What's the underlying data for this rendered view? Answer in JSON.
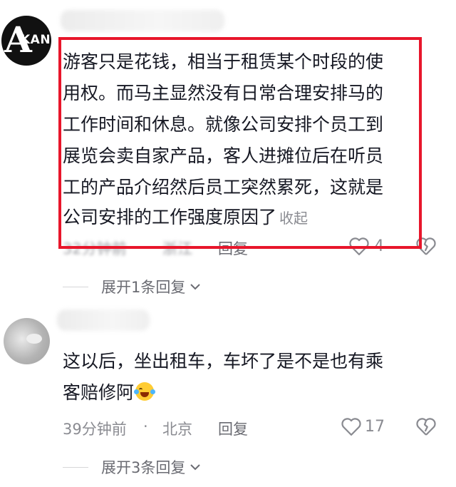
{
  "comments": [
    {
      "avatar_text": "KAN",
      "avatar_letter": "A",
      "lines": [
        "游客只是花钱，相当于租赁某个时段的使",
        "用权。而马主显然没有日常合理安排马的",
        "工作时间和休息。就像公司安排个员工到",
        "展览会卖自家产品，客人进摊位后在听员",
        "工的产品介绍然后员工突然累死，这就是",
        "公司安排的工作强度原因了"
      ],
      "collapse_label": "收起",
      "time": "32分钟前",
      "location": "浙江",
      "reply_label": "回复",
      "likes": "4",
      "expand_label": "展开1条回复"
    },
    {
      "lines": [
        "这以后，坐出租车，车坏了是不是也有乘",
        "客赔修阿"
      ],
      "emoji": "rolling-on-floor-laughing-emoji",
      "time": "39分钟前",
      "dot": "·",
      "location": "北京",
      "reply_label": "回复",
      "likes": "17",
      "expand_label": "展开3条回复"
    }
  ],
  "colors": {
    "highlight_box": "#e8162b",
    "text": "#161823",
    "meta": "#8a8b91"
  }
}
